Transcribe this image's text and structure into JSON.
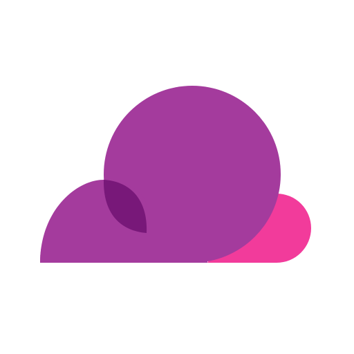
{
  "logo": {
    "icon": "cloud-logo-icon",
    "colors": {
      "main": "#A43B9D",
      "pink": "#F23B9B",
      "overlap": "#781879",
      "background": "#FFFFFF"
    }
  }
}
